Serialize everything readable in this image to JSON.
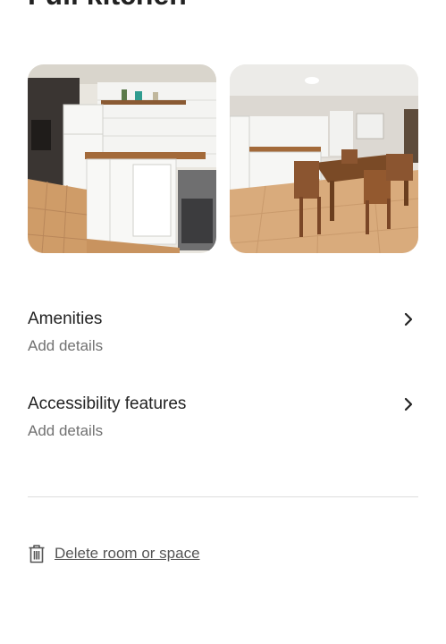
{
  "header": {
    "title": "Full kitchen"
  },
  "photos": [
    {
      "name": "kitchen-photo"
    },
    {
      "name": "dining-photo"
    }
  ],
  "rows": {
    "amenities": {
      "title": "Amenities",
      "subtitle": "Add details",
      "icon": "chevron-right-icon"
    },
    "accessibility": {
      "title": "Accessibility features",
      "subtitle": "Add details",
      "icon": "chevron-right-icon"
    }
  },
  "delete": {
    "label": "Delete room or space",
    "icon": "trash-icon"
  },
  "colors": {
    "text": "#222222",
    "muted": "#717171",
    "divider": "#dddddd"
  }
}
